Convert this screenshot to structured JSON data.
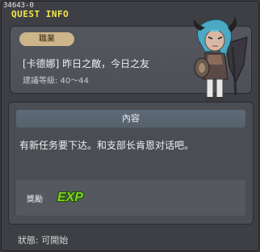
{
  "window": {
    "id_label": "34643-0",
    "title": "QUEST INFO"
  },
  "header": {
    "job_label": "職業",
    "quest_name": "[卡德娜] 昨日之敵，今日之友",
    "level_text": "建議等級: 40～44",
    "npc_icon": "npc-kadena-portrait"
  },
  "content": {
    "header_label": "內容",
    "description": "有新任务要下达。和支部长肯恩对话吧。"
  },
  "reward": {
    "label": "獎勵",
    "exp_text": "EXP",
    "exp_icon": "exp-icon"
  },
  "status": {
    "text": "狀態: 可開始"
  },
  "colors": {
    "title": "#f5e84a",
    "exp_green": "#7cd81e",
    "job_pill": "#cdb58a"
  }
}
